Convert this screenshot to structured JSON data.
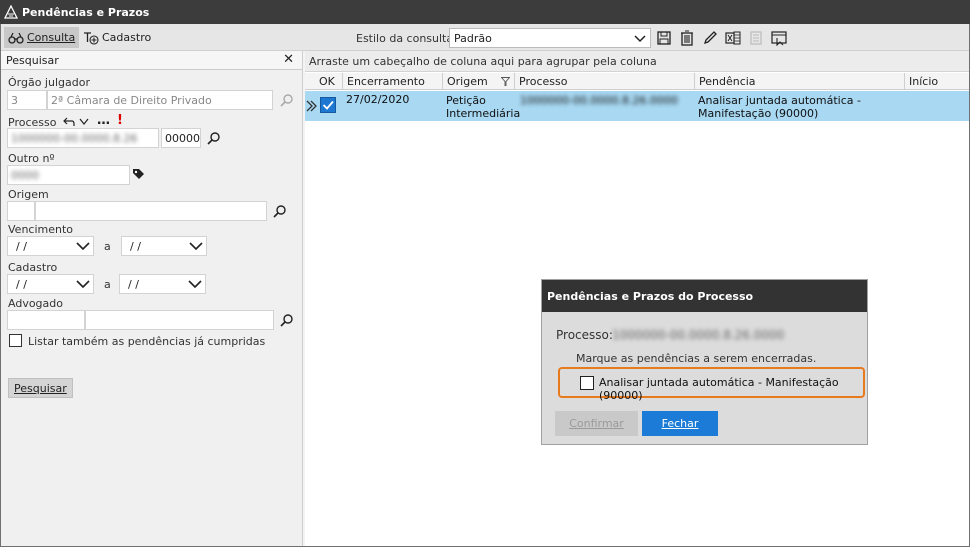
{
  "window": {
    "title": "Pendências e Prazos"
  },
  "tabs": {
    "consulta": "Consulta",
    "cadastro": "Cadastro"
  },
  "estilo": {
    "label": "Estilo da consulta",
    "value": "Padrão"
  },
  "left": {
    "header": "Pesquisar",
    "orgao": {
      "label": "Órgão julgador",
      "code": "3",
      "name": "2ª Câmara de Direito Privado"
    },
    "processo": {
      "label": "Processo",
      "value_blurred": "1000000-00.0000.8.26",
      "suffix": "00000"
    },
    "outro": {
      "label": "Outro nº",
      "value_blurred": "0000"
    },
    "origem": {
      "label": "Origem"
    },
    "vencimento": {
      "label": "Vencimento",
      "from": " / /",
      "to": " / /",
      "a": "a"
    },
    "cadastro": {
      "label": "Cadastro",
      "from": " / /",
      "to": " / /",
      "a": "a"
    },
    "advogado": {
      "label": "Advogado"
    },
    "listar": "Listar também as pendências já cumpridas",
    "pesquisar_btn": "Pesquisar"
  },
  "grid": {
    "group_hint": "Arraste um cabeçalho de coluna aqui para agrupar pela coluna",
    "columns": [
      "OK",
      "Encerramento",
      "Origem",
      "Processo",
      "Pendência",
      "Início"
    ],
    "rows": [
      {
        "encerramento": "27/02/2020",
        "origem": "Petição Intermediária",
        "processo_blurred": "1000000-00.0000.8.26.0000",
        "pendencia": "Analisar juntada automática - Manifestação (90000)"
      }
    ]
  },
  "dialog": {
    "title": "Pendências e Prazos do Processo",
    "processo_label": "Processo:",
    "processo_blurred": "1000000-00.0000.8.26.0000",
    "hint": "Marque as pendências a serem encerradas.",
    "item": "Analisar juntada automática - Manifestação (90000)",
    "confirmar": "Confirmar",
    "fechar": "Fechar"
  }
}
